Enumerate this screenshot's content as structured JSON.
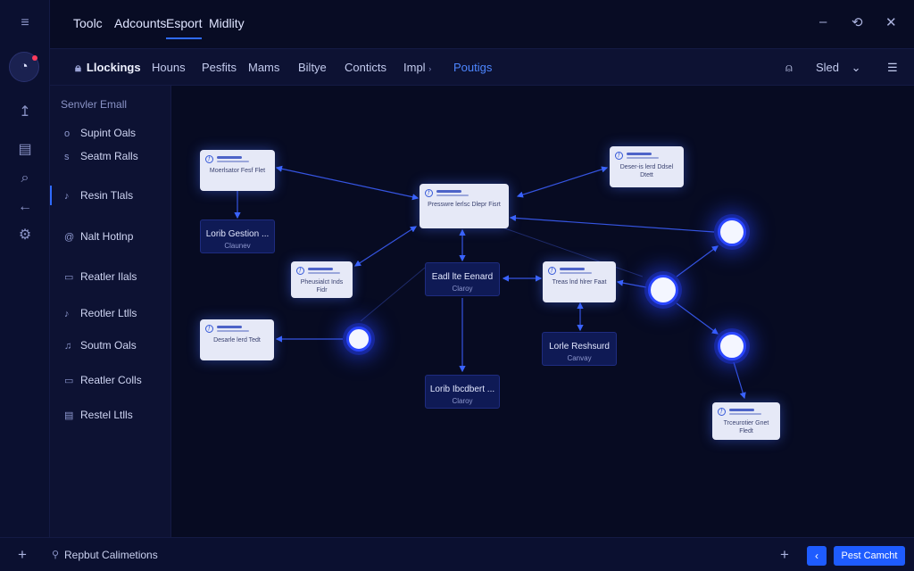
{
  "top_menu": [
    {
      "label": "Toolc"
    },
    {
      "label": "Adcounts"
    },
    {
      "label": "Esport"
    },
    {
      "label": "Midlity"
    }
  ],
  "window_controls": {
    "minimize": "–",
    "share": "⟲",
    "close": "✕"
  },
  "tabs": [
    {
      "label": "Llockings"
    },
    {
      "label": "Houns"
    },
    {
      "label": "Pesfits"
    },
    {
      "label": "Mams"
    },
    {
      "label": "Biltye"
    },
    {
      "label": "Conticts"
    },
    {
      "label": "Impl"
    },
    {
      "label": "Poutigs"
    }
  ],
  "tab_right": {
    "user_label": "Sled"
  },
  "left_panel": {
    "title": "Senvler Emall",
    "items": [
      {
        "label": "Supint Oals",
        "icon": "o"
      },
      {
        "label": "Seatm Ralls",
        "icon": "s"
      },
      {
        "label": "Resin Tlals",
        "icon": "♪"
      },
      {
        "label": "Nalt Hotlnp",
        "icon": "@"
      },
      {
        "label": "Reatler Ilals",
        "icon": "▭"
      },
      {
        "label": "Reotler Ltlls",
        "icon": "♪"
      },
      {
        "label": "Soutm Oals",
        "icon": "♫"
      },
      {
        "label": "Reatler Colls",
        "icon": "▭"
      },
      {
        "label": "Restel Ltlls",
        "icon": "▤"
      }
    ]
  },
  "graph": {
    "cards": [
      {
        "id": "c1",
        "text": "Moerlsator Fesf Flet"
      },
      {
        "id": "c2",
        "text": "Presswre lerlsc Dlepr Fisrt"
      },
      {
        "id": "c3",
        "text": "Deser-is lerd Ddsel Dtett"
      },
      {
        "id": "c4",
        "text": "Pheusialct Inds Fidr"
      },
      {
        "id": "c5",
        "text": "Treas lnd hlrer Faat"
      },
      {
        "id": "c6",
        "text": "Desarle lerd Tedt"
      },
      {
        "id": "c7",
        "text": "Trceurotier Gnet Fledt"
      }
    ],
    "dark_nodes": [
      {
        "id": "d1",
        "title": "Lorib Gestion ...",
        "sub": "Claunev"
      },
      {
        "id": "d2",
        "title": "Eadl lte Eenard",
        "sub": "Claroy"
      },
      {
        "id": "d3",
        "title": "Lorle Reshsurd",
        "sub": "Canvay"
      },
      {
        "id": "d4",
        "title": "Lorib Ibcdbert ...",
        "sub": "Claroy"
      }
    ]
  },
  "bottom_bar": {
    "status_text": "Repbut Calimetions",
    "primary_button": "Pest Camcht"
  },
  "colors": {
    "accent": "#2f6bff",
    "background": "#080c24",
    "panel": "#0d1233"
  }
}
